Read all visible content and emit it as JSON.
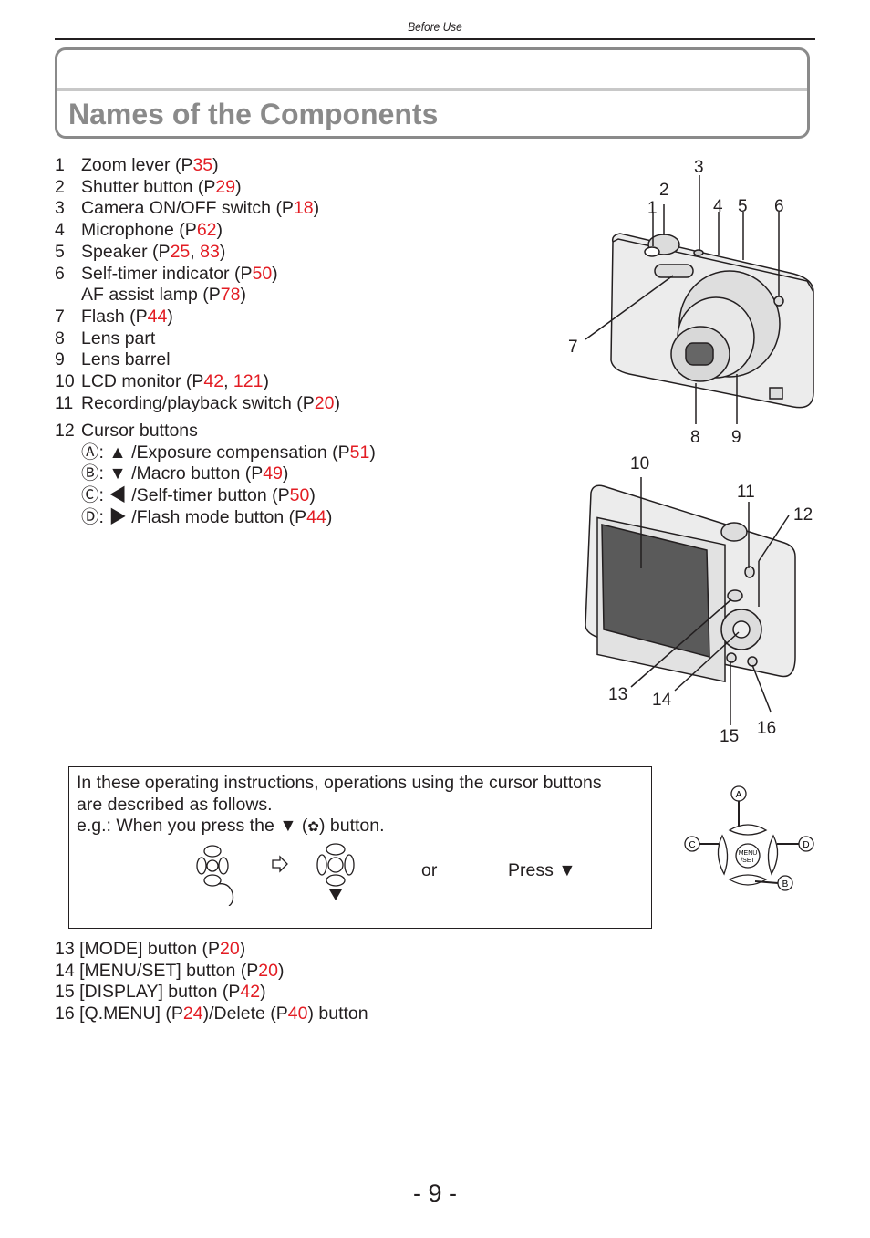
{
  "header": {
    "section": "Before Use",
    "title": "Names of the Components"
  },
  "components_top": [
    {
      "n": "1",
      "text": "Zoom lever (P",
      "refs": [
        "35"
      ],
      "tail": ")"
    },
    {
      "n": "2",
      "text": "Shutter button (P",
      "refs": [
        "29"
      ],
      "tail": ")"
    },
    {
      "n": "3",
      "text": "Camera ON/OFF switch (P",
      "refs": [
        "18"
      ],
      "tail": ")"
    },
    {
      "n": "4",
      "text": "Microphone (P",
      "refs": [
        "62"
      ],
      "tail": ")"
    },
    {
      "n": "5",
      "text": "Speaker (P",
      "refs": [
        "25",
        "83"
      ],
      "tail": ")"
    },
    {
      "n": "6",
      "text": "Self-timer indicator (P",
      "refs": [
        "50"
      ],
      "tail": ")"
    },
    {
      "n": "",
      "text": "AF assist lamp (P",
      "refs": [
        "78"
      ],
      "tail": ")"
    },
    {
      "n": "7",
      "text": "Flash (P",
      "refs": [
        "44"
      ],
      "tail": ")"
    },
    {
      "n": "8",
      "text": "Lens part",
      "refs": [],
      "tail": ""
    },
    {
      "n": "9",
      "text": "Lens barrel",
      "refs": [],
      "tail": ""
    },
    {
      "n": "10",
      "text": "LCD monitor (P",
      "refs": [
        "42",
        "121"
      ],
      "tail": ")"
    },
    {
      "n": "11",
      "text": "Recording/playback switch (P",
      "refs": [
        "20"
      ],
      "tail": ")"
    }
  ],
  "cursor_buttons": {
    "n": "12",
    "title": "Cursor buttons",
    "items": [
      {
        "key": "Ⓐ",
        "arrow": "▲",
        "text": "/Exposure compensation (P",
        "ref": "51"
      },
      {
        "key": "Ⓑ",
        "arrow": "▼",
        "text": "/Macro button (P",
        "ref": "49"
      },
      {
        "key": "Ⓒ",
        "arrow": "◀",
        "text": "/Self-timer button (P",
        "ref": "50"
      },
      {
        "key": "Ⓓ",
        "arrow": "▶",
        "text": "/Flash mode button (P",
        "ref": "44"
      }
    ]
  },
  "front_labels": [
    "1",
    "2",
    "3",
    "4",
    "5",
    "6",
    "7",
    "8",
    "9"
  ],
  "back_labels": [
    "10",
    "11",
    "12",
    "13",
    "14",
    "15",
    "16"
  ],
  "note": {
    "line1": "In these operating instructions, operations using the cursor buttons",
    "line2": "are described as follows.",
    "line3_pre": "e.g.: When you press the ▼ (",
    "line3_post": ") button.",
    "or": "or",
    "press": "Press ▼"
  },
  "cursor_diagram": {
    "labels": [
      "A",
      "B",
      "C",
      "D"
    ],
    "center": [
      "MENU",
      "/SET"
    ]
  },
  "components_bottom": [
    {
      "n": "13",
      "parts": [
        "[MODE] button (P",
        "20",
        ")"
      ]
    },
    {
      "n": "14",
      "parts": [
        "[MENU/SET] button (P",
        "20",
        ")"
      ]
    },
    {
      "n": "15",
      "parts": [
        "[DISPLAY] button (P",
        "42",
        ")"
      ]
    },
    {
      "n": "16",
      "parts": [
        "[Q.MENU] (P",
        "24",
        ")/Delete (P",
        "40",
        ") button"
      ]
    }
  ],
  "page_number": "- 9 -",
  "colors": {
    "ref_red": "#e31c23",
    "title_gray": "#8a8a8a"
  }
}
